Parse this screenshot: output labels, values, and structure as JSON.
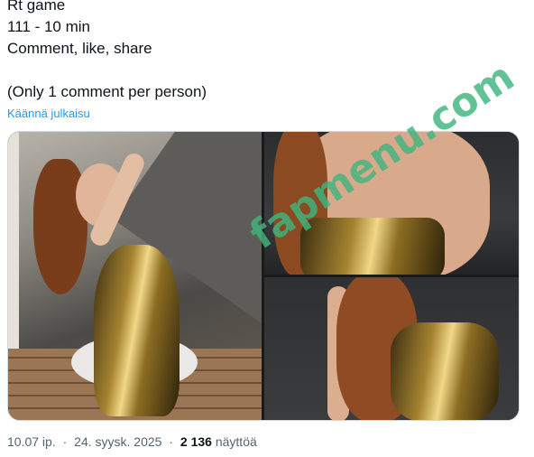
{
  "post": {
    "lines": [
      "Rt game",
      "111 - 10 min",
      "Comment, like, share",
      "",
      "(Only 1 comment per person)"
    ]
  },
  "translate_label": "Käännä julkaisu",
  "media": {
    "photo_count": 3
  },
  "watermark": "fapmenu.com",
  "meta": {
    "time": "10.07 ip.",
    "separator": "·",
    "date": "24. syysk. 2025",
    "views_count": "2 136",
    "views_label": "näyttöä"
  },
  "colors": {
    "link": "#1d9bf0",
    "secondary_text": "#536471",
    "watermark": "#3fb67e"
  }
}
